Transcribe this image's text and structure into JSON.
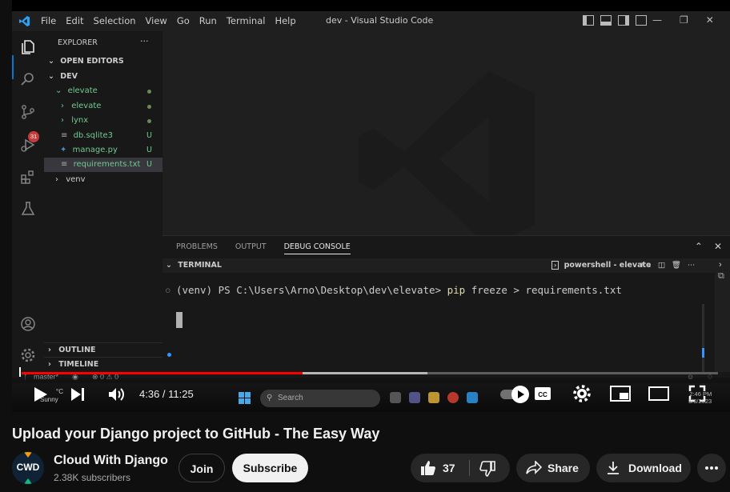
{
  "vscode": {
    "menu": [
      "File",
      "Edit",
      "Selection",
      "View",
      "Go",
      "Run",
      "Terminal",
      "Help"
    ],
    "window_title": "dev - Visual Studio Code",
    "scm_badge": "31",
    "explorer": {
      "title": "EXPLORER",
      "more": "···",
      "open_editors": "OPEN EDITORS",
      "root": "DEV",
      "items": [
        {
          "label": "elevate",
          "status": ""
        },
        {
          "label": "elevate",
          "status": ""
        },
        {
          "label": "lynx",
          "status": ""
        },
        {
          "label": "db.sqlite3",
          "status": "U"
        },
        {
          "label": "manage.py",
          "status": "U"
        },
        {
          "label": "requirements.txt",
          "status": "U"
        },
        {
          "label": "venv",
          "status": ""
        }
      ],
      "outline": "OUTLINE",
      "timeline": "TIMELINE"
    },
    "panel": {
      "tabs": [
        "PROBLEMS",
        "OUTPUT",
        "DEBUG CONSOLE"
      ],
      "terminal_label": "TERMINAL",
      "shell": "powershell - elevate",
      "prompt": "(venv) PS C:\\Users\\Arno\\Desktop\\dev\\elevate>",
      "command": "pip",
      "args": "freeze > requirements.txt"
    },
    "status": {
      "branch": "master*",
      "problems": "⊗ 0 ⚠ 0"
    }
  },
  "player": {
    "time": "4:36 / 11:25",
    "progress": 0.403,
    "buffered": 0.583,
    "taskbar_search": "Search",
    "weather": [
      "°C",
      "Sunny"
    ],
    "clock": [
      "2:46 PM",
      "5/3/2023"
    ]
  },
  "video": {
    "title": "Upload your Django project to GitHub - The Easy Way",
    "channel": "Cloud With Django",
    "avatar_text": "CWD",
    "subscribers": "2.38K subscribers",
    "join_label": "Join",
    "subscribe_label": "Subscribe",
    "likes": "37",
    "share_label": "Share",
    "download_label": "Download"
  }
}
